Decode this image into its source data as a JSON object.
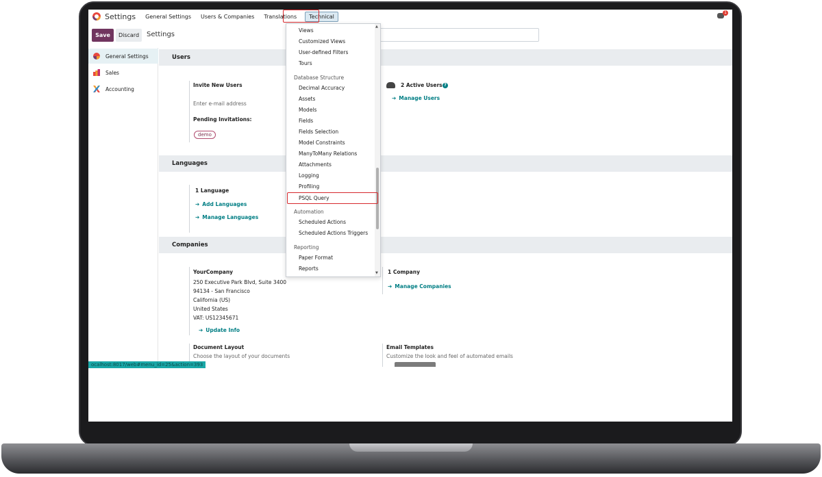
{
  "nav": {
    "app_title": "Settings",
    "menus": [
      "General Settings",
      "Users & Companies",
      "Translations",
      "Technical"
    ],
    "chat_count": "1"
  },
  "control": {
    "save_label": "Save",
    "discard_label": "Discard",
    "breadcrumb": "Settings"
  },
  "sidebar": {
    "items": [
      {
        "label": "General Settings",
        "icon": "general-settings-icon"
      },
      {
        "label": "Sales",
        "icon": "sales-icon"
      },
      {
        "label": "Accounting",
        "icon": "accounting-icon"
      }
    ]
  },
  "users": {
    "title": "Users",
    "invite_label": "Invite New Users",
    "invite_placeholder": "Enter e-mail address",
    "pending_label": "Pending Invitations:",
    "pending_user": "demo",
    "active_users": "2 Active Users",
    "manage_users": "Manage Users"
  },
  "languages": {
    "title": "Languages",
    "count": "1 Language",
    "add": "Add Languages",
    "manage": "Manage Languages"
  },
  "companies": {
    "title": "Companies",
    "name": "YourCompany",
    "address": [
      "250 Executive Park Blvd, Suite 3400",
      "94134 - San Francisco",
      "California (US)",
      "United States",
      "VAT:  US12345671"
    ],
    "update": "Update Info",
    "count": "1 Company",
    "manage": "Manage Companies",
    "doc_layout_title": "Document Layout",
    "doc_layout_desc": "Choose the layout of your documents",
    "email_templates_title": "Email Templates",
    "email_templates_desc": "Customize the look and feel of automated emails"
  },
  "status_url": "ocalhost:8017/web#menu_id=25&action=393",
  "dropdown": {
    "items": [
      {
        "kind": "item",
        "label": "Views"
      },
      {
        "kind": "item",
        "label": "Customized Views"
      },
      {
        "kind": "item",
        "label": "User-defined Filters"
      },
      {
        "kind": "item",
        "label": "Tours"
      },
      {
        "kind": "head",
        "label": "Database Structure"
      },
      {
        "kind": "item",
        "label": "Decimal Accuracy"
      },
      {
        "kind": "item",
        "label": "Assets"
      },
      {
        "kind": "item",
        "label": "Models"
      },
      {
        "kind": "item",
        "label": "Fields"
      },
      {
        "kind": "item",
        "label": "Fields Selection"
      },
      {
        "kind": "item",
        "label": "Model Constraints"
      },
      {
        "kind": "item",
        "label": "ManyToMany Relations"
      },
      {
        "kind": "item",
        "label": "Attachments"
      },
      {
        "kind": "item",
        "label": "Logging"
      },
      {
        "kind": "item",
        "label": "Profiling"
      },
      {
        "kind": "item",
        "label": "PSQL Query"
      },
      {
        "kind": "head",
        "label": "Automation"
      },
      {
        "kind": "item",
        "label": "Scheduled Actions"
      },
      {
        "kind": "item",
        "label": "Scheduled Actions Triggers"
      },
      {
        "kind": "head",
        "label": "Reporting"
      },
      {
        "kind": "item",
        "label": "Paper Format"
      },
      {
        "kind": "item",
        "label": "Reports"
      }
    ]
  },
  "colors": {
    "brand": "#71355f",
    "link": "#017e84",
    "highlight": "#d6282c"
  }
}
